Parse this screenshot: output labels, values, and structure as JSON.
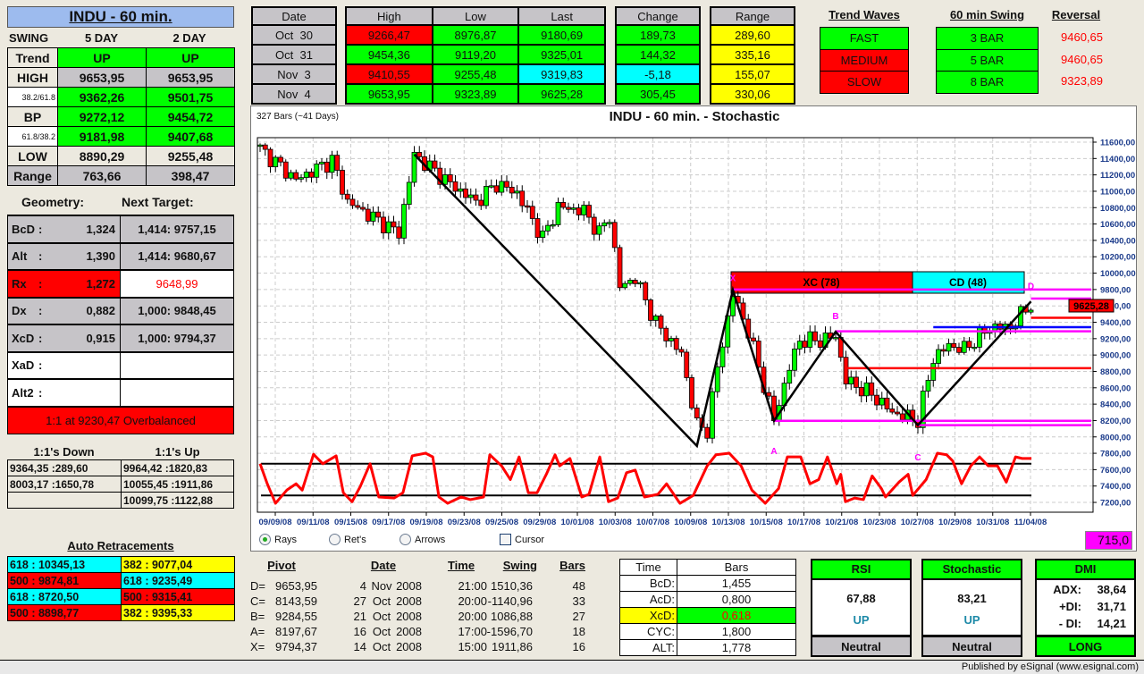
{
  "colors": {
    "g": "#00ff00",
    "r": "#ff0000",
    "c": "#00ffff",
    "y": "#ffff00",
    "s": "#c6c4c8",
    "w": "#ffffff",
    "b": "#ece9df",
    "m": "#ff00ff"
  },
  "title": "INDU - 60 min.",
  "swing": {
    "headers": [
      "SWING",
      "5 DAY",
      "2 DAY"
    ],
    "rows": [
      {
        "label": "Trend",
        "v": [
          "UP",
          "UP"
        ],
        "lc": "b",
        "c": [
          "g",
          "g"
        ]
      },
      {
        "label": "HIGH",
        "v": [
          "9653,95",
          "9653,95"
        ],
        "lc": "b",
        "c": [
          "s",
          "s"
        ]
      },
      {
        "label": "38.2/61.8",
        "v": [
          "9362,26",
          "9501,75"
        ],
        "lc": "w",
        "c": [
          "g",
          "g"
        ],
        "small": true
      },
      {
        "label": "BP",
        "v": [
          "9272,12",
          "9454,72"
        ],
        "lc": "b",
        "c": [
          "g",
          "g"
        ]
      },
      {
        "label": "61.8/38.2",
        "v": [
          "9181,98",
          "9407,68"
        ],
        "lc": "w",
        "c": [
          "g",
          "g"
        ],
        "small": true
      },
      {
        "label": "LOW",
        "v": [
          "8890,29",
          "9255,48"
        ],
        "lc": "b",
        "c": [
          "b",
          "b"
        ]
      },
      {
        "label": "Range",
        "v": [
          "763,66",
          "398,47"
        ],
        "lc": "s",
        "c": [
          "s",
          "s"
        ]
      }
    ]
  },
  "geometry": {
    "headers": [
      "Geometry:",
      "Next Target:"
    ],
    "rows": [
      {
        "label": "BcD",
        "sep": ":",
        "value": "1,324",
        "target": "1,414: 9757,15",
        "c": "s",
        "tc": "s"
      },
      {
        "label": "Alt",
        "sep": ":",
        "value": "1,390",
        "target": "1,414: 9680,67",
        "c": "s",
        "tc": "s"
      },
      {
        "label": "Rx",
        "sep": ":",
        "value": "1,272",
        "target": "9648,99",
        "c": "r",
        "tc": "w",
        "tred": true
      },
      {
        "label": "Dx",
        "sep": ":",
        "value": "0,882",
        "target": "1,000: 9848,45",
        "c": "s",
        "tc": "s"
      },
      {
        "label": "XcD",
        "sep": ":",
        "value": "0,915",
        "target": "1,000: 9794,37",
        "c": "s",
        "tc": "s"
      },
      {
        "label": "XaD",
        "sep": ":",
        "value": "",
        "target": "",
        "c": "w",
        "tc": "w"
      },
      {
        "label": "Alt2",
        "sep": ":",
        "value": "",
        "target": "",
        "c": "w",
        "tc": "w"
      }
    ],
    "footer": "1:1 at 9230,47 Overbalanced"
  },
  "ones": {
    "headers": [
      "1:1's Down",
      "1:1's Up"
    ],
    "rows": [
      [
        "9364,35 :289,60",
        "9964,42 :1820,83"
      ],
      [
        "8003,17 :1650,78",
        "10055,45 :1911,86"
      ],
      [
        "",
        "10099,75 :1122,88"
      ]
    ]
  },
  "retracements": {
    "title": "Auto Retracements",
    "rows": [
      [
        {
          "t": "618 : 10345,13",
          "c": "c"
        },
        {
          "t": "382 : 9077,04",
          "c": "y"
        }
      ],
      [
        {
          "t": "500 : 9874,81",
          "c": "r"
        },
        {
          "t": "618 : 9235,49",
          "c": "c"
        }
      ],
      [
        {
          "t": "618 : 8720,50",
          "c": "c"
        },
        {
          "t": "500 : 9315,41",
          "c": "r"
        }
      ],
      [
        {
          "t": "500 : 8898,77",
          "c": "r"
        },
        {
          "t": "382 : 9395,33",
          "c": "y"
        }
      ]
    ]
  },
  "quotes": {
    "date_header": "Date",
    "dates": [
      "Oct  30",
      "Oct  31",
      "Nov  3",
      "Nov  4"
    ],
    "hll_headers": [
      "High",
      "Low",
      "Last"
    ],
    "hll": [
      [
        {
          "t": "9266,47",
          "c": "r"
        },
        {
          "t": "8976,87",
          "c": "g"
        },
        {
          "t": "9180,69",
          "c": "g"
        }
      ],
      [
        {
          "t": "9454,36",
          "c": "g"
        },
        {
          "t": "9119,20",
          "c": "g"
        },
        {
          "t": "9325,01",
          "c": "g"
        }
      ],
      [
        {
          "t": "9410,55",
          "c": "r"
        },
        {
          "t": "9255,48",
          "c": "g"
        },
        {
          "t": "9319,83",
          "c": "c"
        }
      ],
      [
        {
          "t": "9653,95",
          "c": "g"
        },
        {
          "t": "9323,89",
          "c": "g"
        },
        {
          "t": "9625,28",
          "c": "g"
        }
      ]
    ],
    "change_header": "Change",
    "change": [
      {
        "t": "189,73",
        "c": "g"
      },
      {
        "t": "144,32",
        "c": "g"
      },
      {
        "t": "-5,18",
        "c": "c"
      },
      {
        "t": "305,45",
        "c": "g"
      }
    ],
    "range_header": "Range",
    "range": [
      {
        "t": "289,60",
        "c": "y"
      },
      {
        "t": "335,16",
        "c": "y"
      },
      {
        "t": "155,07",
        "c": "y"
      },
      {
        "t": "330,06",
        "c": "y"
      }
    ]
  },
  "trend_waves": {
    "header": "Trend Waves",
    "rows": [
      {
        "t": "FAST",
        "c": "g"
      },
      {
        "t": "MEDIUM",
        "c": "r"
      },
      {
        "t": "SLOW",
        "c": "r"
      }
    ]
  },
  "swing60": {
    "header": "60 min Swing",
    "rows": [
      {
        "t": "3 BAR",
        "c": "g"
      },
      {
        "t": "5 BAR",
        "c": "g"
      },
      {
        "t": "8 BAR",
        "c": "g"
      }
    ]
  },
  "reversal": {
    "header": "Reversal",
    "values": [
      "9460,65",
      "9460,65",
      "9323,89"
    ]
  },
  "chart": {
    "bars_info": "327 Bars (~41 Days)",
    "title": "INDU - 60 min. - Stochastic",
    "radios": [
      {
        "label": "Rays",
        "checked": true
      },
      {
        "label": "Ret's",
        "checked": false
      },
      {
        "label": "Arrows",
        "checked": false
      }
    ],
    "cursor_label": "Cursor",
    "cursor_checked": false,
    "readout": "715,0",
    "last_tag": "9625,28",
    "xc_label": "XC (78)",
    "cd_label": "CD (48)",
    "point_labels": [
      "X",
      "A",
      "B",
      "C",
      "D"
    ]
  },
  "chart_data": {
    "type": "candlestick",
    "title": "INDU - 60 min. - Stochastic",
    "ylim": [
      7100,
      11700
    ],
    "y_ticks": [
      "11600,00",
      "11400,00",
      "11200,00",
      "11000,00",
      "10800,00",
      "10600,00",
      "10400,00",
      "10200,00",
      "10000,00",
      "9800,00",
      "9600,00",
      "9400,00",
      "9200,00",
      "9000,00",
      "8800,00",
      "8600,00",
      "8400,00",
      "8200,00",
      "8000,00",
      "7800,00",
      "7600,00",
      "7400,00",
      "7200,00"
    ],
    "x_ticks": [
      "09/09/08",
      "09/11/08",
      "09/15/08",
      "09/17/08",
      "09/19/08",
      "09/23/08",
      "09/25/08",
      "09/29/08",
      "10/01/08",
      "10/03/08",
      "10/07/08",
      "10/09/08",
      "10/13/08",
      "10/15/08",
      "10/17/08",
      "10/21/08",
      "10/23/08",
      "10/27/08",
      "10/29/08",
      "10/31/08",
      "11/04/08"
    ],
    "price_path": [
      [
        0,
        11520
      ],
      [
        7,
        11140
      ],
      [
        14,
        11380
      ],
      [
        17,
        10870
      ],
      [
        27,
        10490
      ],
      [
        30,
        11450
      ],
      [
        37,
        11090
      ],
      [
        42,
        10870
      ],
      [
        46,
        11090
      ],
      [
        50,
        10980
      ],
      [
        55,
        10430
      ],
      [
        58,
        10810
      ],
      [
        63,
        10760
      ],
      [
        66,
        10490
      ],
      [
        68,
        10700
      ],
      [
        70,
        9830
      ],
      [
        73,
        9940
      ],
      [
        77,
        9390
      ],
      [
        82,
        9010
      ],
      [
        85,
        8140
      ],
      [
        87,
        8085
      ],
      [
        89,
        8850
      ],
      [
        92,
        9745
      ],
      [
        95,
        9290
      ],
      [
        100,
        8200
      ],
      [
        103,
        8850
      ],
      [
        105,
        9180
      ],
      [
        109,
        9180
      ],
      [
        112,
        9230
      ],
      [
        114,
        8690
      ],
      [
        119,
        8520
      ],
      [
        123,
        8300
      ],
      [
        128,
        8200
      ],
      [
        131,
        8960
      ],
      [
        134,
        9120
      ],
      [
        137,
        9070
      ],
      [
        142,
        9340
      ],
      [
        146,
        9340
      ],
      [
        149,
        9560
      ],
      [
        150,
        9625
      ]
    ],
    "stochastic": [
      [
        0,
        80
      ],
      [
        1.4,
        42
      ],
      [
        3,
        5
      ],
      [
        5.2,
        30
      ],
      [
        7,
        42
      ],
      [
        8.2,
        30
      ],
      [
        10.4,
        98
      ],
      [
        12.2,
        80
      ],
      [
        14.8,
        95
      ],
      [
        16.2,
        25
      ],
      [
        17.9,
        8
      ],
      [
        19.5,
        37
      ],
      [
        21.4,
        80
      ],
      [
        23.1,
        17
      ],
      [
        26.1,
        15
      ],
      [
        27.8,
        25
      ],
      [
        29.6,
        95
      ],
      [
        32.2,
        100
      ],
      [
        33.6,
        93
      ],
      [
        34.8,
        17
      ],
      [
        36.5,
        5
      ],
      [
        39.1,
        17
      ],
      [
        40.9,
        12
      ],
      [
        43.5,
        17
      ],
      [
        44.7,
        97
      ],
      [
        47,
        76
      ],
      [
        48.7,
        50
      ],
      [
        50.4,
        93
      ],
      [
        52.2,
        25
      ],
      [
        53.9,
        25
      ],
      [
        55.7,
        60
      ],
      [
        57.4,
        97
      ],
      [
        58.3,
        76
      ],
      [
        60.3,
        90
      ],
      [
        62.6,
        17
      ],
      [
        64,
        22
      ],
      [
        66.1,
        93
      ],
      [
        67.8,
        8
      ],
      [
        69.6,
        15
      ],
      [
        71.3,
        63
      ],
      [
        73,
        68
      ],
      [
        74.8,
        17
      ],
      [
        77.4,
        22
      ],
      [
        79.1,
        42
      ],
      [
        81.7,
        5
      ],
      [
        84.3,
        20
      ],
      [
        87,
        76
      ],
      [
        88.7,
        97
      ],
      [
        91.3,
        100
      ],
      [
        93.6,
        76
      ],
      [
        95.7,
        30
      ],
      [
        98.3,
        5
      ],
      [
        100.9,
        33
      ],
      [
        102.6,
        93
      ],
      [
        105.2,
        93
      ],
      [
        107,
        42
      ],
      [
        108.7,
        50
      ],
      [
        110.4,
        93
      ],
      [
        112.2,
        42
      ],
      [
        113,
        60
      ],
      [
        113.9,
        8
      ],
      [
        115.7,
        15
      ],
      [
        117.4,
        12
      ],
      [
        119.1,
        57
      ],
      [
        120.9,
        33
      ],
      [
        121.7,
        17
      ],
      [
        124.3,
        45
      ],
      [
        126.1,
        60
      ],
      [
        127,
        20
      ],
      [
        129.6,
        50
      ],
      [
        131.8,
        100
      ],
      [
        133.6,
        97
      ],
      [
        134.8,
        85
      ],
      [
        136.5,
        42
      ],
      [
        138.3,
        76
      ],
      [
        140,
        93
      ],
      [
        141.7,
        76
      ],
      [
        143.5,
        76
      ],
      [
        145.2,
        45
      ],
      [
        147,
        93
      ],
      [
        148.3,
        90
      ],
      [
        150.1,
        90
      ]
    ],
    "stoch_levels": [
      80,
      20
    ],
    "pattern": [
      [
        30,
        11450
      ],
      [
        85,
        7890
      ],
      [
        92,
        9794.37
      ],
      [
        100,
        8197.67
      ],
      [
        112,
        9284.55
      ],
      [
        128,
        8143.59
      ],
      [
        150,
        9653.95
      ]
    ],
    "levels": [
      {
        "price": 9800,
        "from": 92,
        "color": "m"
      },
      {
        "price": 9290,
        "from": 112,
        "color": "m"
      },
      {
        "price": 8197,
        "from": 100,
        "color": "m"
      },
      {
        "price": 8143,
        "from": 128,
        "color": "m"
      },
      {
        "price": 8840,
        "from": 114,
        "color": "r"
      },
      {
        "price": 9340,
        "from": 131,
        "color": "blue"
      },
      {
        "price": 9455,
        "from": 150,
        "color": "r"
      },
      {
        "price": 9690,
        "from": 150,
        "color": "m"
      }
    ]
  },
  "pivots": {
    "headers": [
      "Pivot",
      "Date",
      "Time",
      "Swing",
      "Bars"
    ],
    "rows": [
      [
        "D=",
        "9653,95",
        "4",
        "Nov",
        "2008",
        "21:00",
        "1510,36",
        "48"
      ],
      [
        "C=",
        "8143,59",
        "27",
        "Oct",
        "2008",
        "20:00",
        "-1140,96",
        "33"
      ],
      [
        "B=",
        "9284,55",
        "21",
        "Oct",
        "2008",
        "20:00",
        "1086,88",
        "27"
      ],
      [
        "A=",
        "8197,67",
        "16",
        "Oct",
        "2008",
        "17:00",
        "-1596,70",
        "18"
      ],
      [
        "X=",
        "9794,37",
        "14",
        "Oct",
        "2008",
        "15:00",
        "1911,86",
        "16"
      ]
    ]
  },
  "time_bars": {
    "headers": [
      "Time",
      "Bars"
    ],
    "rows": [
      [
        "BcD:",
        "1,455"
      ],
      [
        "AcD:",
        "0,800"
      ],
      [
        "XcD:",
        "0,618"
      ],
      [
        "CYC:",
        "1,800"
      ],
      [
        "ALT:",
        "1,778"
      ]
    ]
  },
  "indicators": {
    "rsi": {
      "title": "RSI",
      "value": "67,88",
      "dir": "UP",
      "footer": "Neutral"
    },
    "stoch": {
      "title": "Stochastic",
      "value": "83,21",
      "dir": "UP",
      "footer": "Neutral"
    },
    "dmi": {
      "title": "DMI",
      "rows": [
        [
          "ADX:",
          "38,64"
        ],
        [
          "+DI:",
          "31,71"
        ],
        [
          "- DI:",
          "14,21"
        ]
      ],
      "footer": "LONG"
    }
  },
  "status": "Published by eSignal (www.esignal.com)"
}
